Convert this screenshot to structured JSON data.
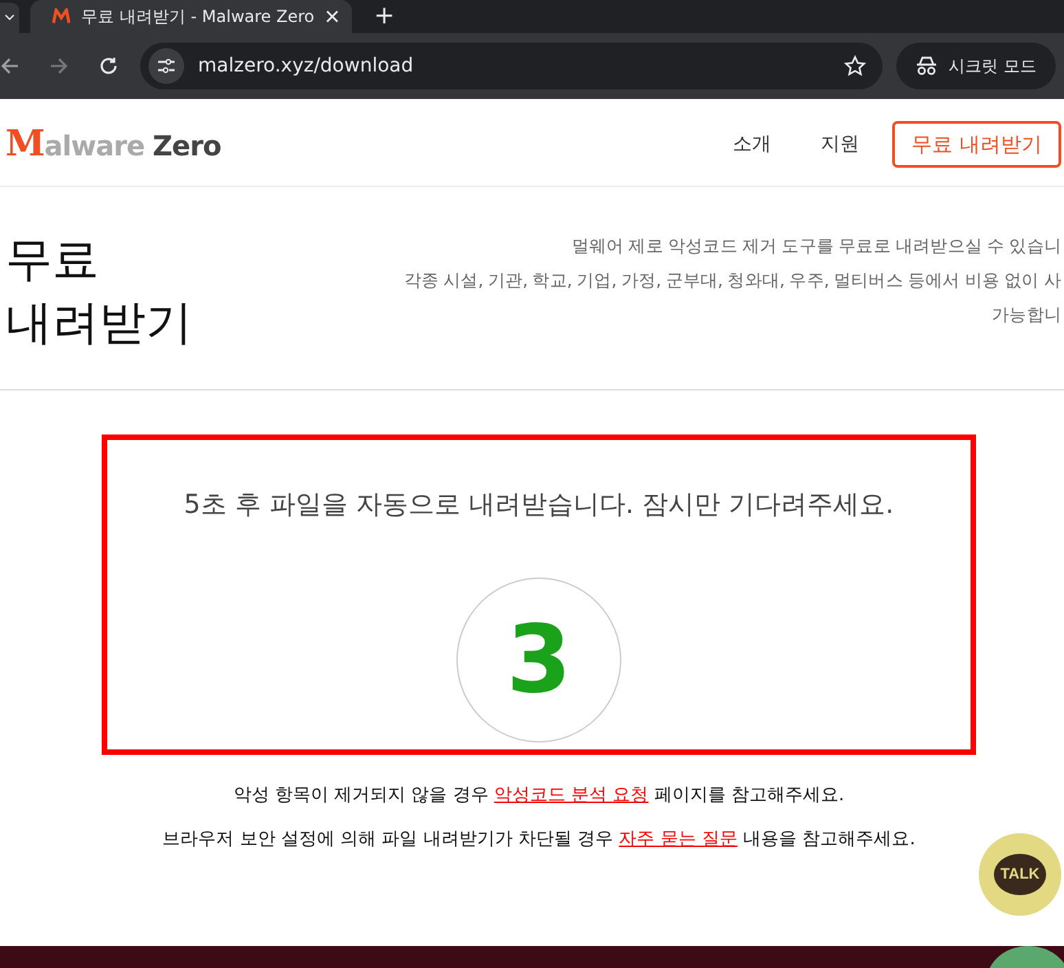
{
  "browser": {
    "tab": {
      "title": "무료 내려받기 - Malware Zero",
      "selected": true
    },
    "new_tab": "+",
    "url": "malzero.xyz/download",
    "incognito": "시크릿 모드"
  },
  "header": {
    "logo": {
      "mark": "M",
      "middle": "alware",
      "end": "Zero"
    },
    "nav": [
      "소개",
      "지원"
    ],
    "cta": "무료 내려받기"
  },
  "hero": {
    "title_lines": [
      "무료",
      "내려받기"
    ],
    "description_lines": [
      "멀웨어 제로 악성코드 제거 도구를 무료로 내려받으실 수 있습니",
      "각종 시설, 기관, 학교, 기업, 가정, 군부대, 청와대, 우주, 멀티버스 등에서 비용 없이 사",
      "가능합니"
    ]
  },
  "download": {
    "message": "5초 후 파일을 자동으로 내려받습니다. 잠시만 기다려주세요.",
    "countdown": "3"
  },
  "notes": [
    {
      "before": "악성 항목이 제거되지 않을 경우 ",
      "link": "악성코드 분석 요청",
      "after": " 페이지를 참고해주세요."
    },
    {
      "before": "브라우저 보안 설정에 의해 파일 내려받기가 차단될 경우 ",
      "link": "자주 묻는 질문",
      "after": " 내용을 참고해주세요."
    }
  ],
  "chat_button": "TALK"
}
